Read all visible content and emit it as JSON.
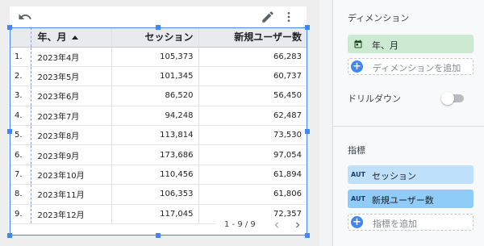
{
  "table": {
    "headers": {
      "index": "",
      "month": "年、月",
      "sessions": "セッション",
      "new_users": "新規ユーザー数"
    },
    "rows": [
      {
        "idx": "1.",
        "month": "2023年4月",
        "sessions": "105,373",
        "new_users": "66,283"
      },
      {
        "idx": "2.",
        "month": "2023年5月",
        "sessions": "101,345",
        "new_users": "60,737"
      },
      {
        "idx": "3.",
        "month": "2023年6月",
        "sessions": "86,520",
        "new_users": "56,450"
      },
      {
        "idx": "4.",
        "month": "2023年7月",
        "sessions": "94,248",
        "new_users": "62,487"
      },
      {
        "idx": "5.",
        "month": "2023年8月",
        "sessions": "113,814",
        "new_users": "73,530"
      },
      {
        "idx": "6.",
        "month": "2023年9月",
        "sessions": "173,686",
        "new_users": "97,054"
      },
      {
        "idx": "7.",
        "month": "2023年10月",
        "sessions": "110,456",
        "new_users": "61,894"
      },
      {
        "idx": "8.",
        "month": "2023年11月",
        "sessions": "106,353",
        "new_users": "61,806"
      },
      {
        "idx": "9.",
        "month": "2023年12月",
        "sessions": "117,045",
        "new_users": "72,357"
      }
    ],
    "sort": "ascending",
    "pagination": "1 - 9 / 9"
  },
  "toolbar": {
    "undo_icon": "undo-icon",
    "edit_icon": "pencil-icon",
    "more_icon": "more-vert-icon"
  },
  "panel": {
    "dimension_title": "ディメンション",
    "dimension_chip": "年、月",
    "dimension_chip_icon": "calendar-icon",
    "add_dimension": "ディメンションを追加",
    "drilldown_label": "ドリルダウン",
    "drilldown_enabled": false,
    "metric_title": "指標",
    "metrics": [
      {
        "type": "AUT",
        "label": "セッション"
      },
      {
        "type": "AUT",
        "label": "新規ユーザー数"
      }
    ],
    "add_metric": "指標を追加"
  },
  "colors": {
    "selection": "#4285f4",
    "dimension_chip": "#ccead2",
    "metric_chip": "#bfe0fb",
    "metric_chip_active": "#90ccf8"
  }
}
